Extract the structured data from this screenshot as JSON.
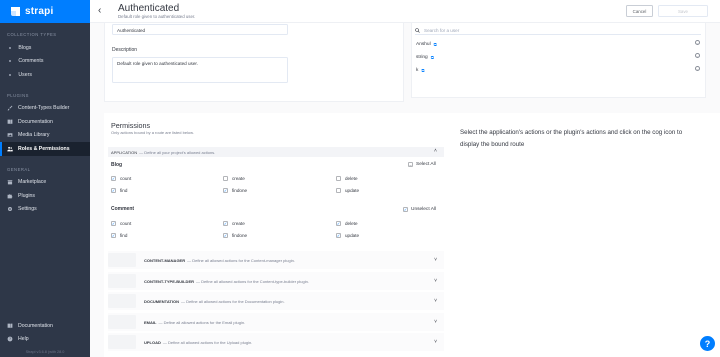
{
  "brand": {
    "name": "strapi"
  },
  "sidebar": {
    "collection_types_title": "COLLECTION TYPES",
    "collection_items": [
      {
        "label": "Blogs"
      },
      {
        "label": "Comments"
      },
      {
        "label": "Users"
      }
    ],
    "plugins_title": "PLUGINS",
    "plugin_items": [
      {
        "label": "Content-Types Builder",
        "icon": "paintbrush-icon"
      },
      {
        "label": "Documentation",
        "icon": "book-icon"
      },
      {
        "label": "Media Library",
        "icon": "image-icon"
      },
      {
        "label": "Roles & Permissions",
        "icon": "users-icon",
        "active": true
      }
    ],
    "general_title": "GENERAL",
    "general_items": [
      {
        "label": "Marketplace",
        "icon": "store-icon"
      },
      {
        "label": "Plugins",
        "icon": "puzzle-icon"
      },
      {
        "label": "Settings",
        "icon": "gear-icon"
      }
    ],
    "bottom_items": [
      {
        "label": "Documentation",
        "icon": "book-icon"
      },
      {
        "label": "Help",
        "icon": "help-icon"
      }
    ],
    "version": "Strapi v3.6.8 (with 28.0"
  },
  "header": {
    "title": "Authenticated",
    "subtitle": "Default role given to authenticated user.",
    "cancel_label": "Cancel",
    "save_label": "Save"
  },
  "form": {
    "name_value": "Authenticated",
    "description_label": "Description",
    "description_value": "Default role given to authenticated user."
  },
  "users": {
    "search_placeholder": "Search for a user",
    "list": [
      {
        "name": "Anshul"
      },
      {
        "name": "string"
      },
      {
        "name": "k"
      }
    ]
  },
  "permissions": {
    "title": "Permissions",
    "subtitle": "Only actions bound by a route are listed below.",
    "application_label": "APPLICATION",
    "application_desc": "— Define all your project's allowed actions.",
    "groups": [
      {
        "name": "Blog",
        "toggle_label": "Select All",
        "actions": [
          {
            "label": "count",
            "checked": true
          },
          {
            "label": "create",
            "checked": false
          },
          {
            "label": "delete",
            "checked": false
          },
          {
            "label": "find",
            "checked": true
          },
          {
            "label": "findone",
            "checked": true
          },
          {
            "label": "update",
            "checked": false
          }
        ]
      },
      {
        "name": "Comment",
        "toggle_label": "Unselect All",
        "actions": [
          {
            "label": "count",
            "checked": true
          },
          {
            "label": "create",
            "checked": true
          },
          {
            "label": "delete",
            "checked": true
          },
          {
            "label": "find",
            "checked": true
          },
          {
            "label": "findone",
            "checked": true
          },
          {
            "label": "update",
            "checked": true
          }
        ]
      }
    ],
    "plugins": [
      {
        "name": "CONTENT-MANAGER",
        "desc": "— Define all allowed actions for the Content-manager plugin."
      },
      {
        "name": "CONTENT-TYPE-BUILDER",
        "desc": "— Define all allowed actions for the Content-type-builder plugin."
      },
      {
        "name": "DOCUMENTATION",
        "desc": "— Define all allowed actions for the Documentation plugin."
      },
      {
        "name": "EMAIL",
        "desc": "— Define all allowed actions for the Email plugin."
      },
      {
        "name": "UPLOAD",
        "desc": "— Define all allowed actions for the Upload plugin."
      }
    ]
  },
  "route_panel": {
    "text": "Select the application's actions or the plugin's actions and click on the cog icon to display the bound route"
  },
  "colors": {
    "accent": "#007eff",
    "sidebar": "#2e3748"
  }
}
